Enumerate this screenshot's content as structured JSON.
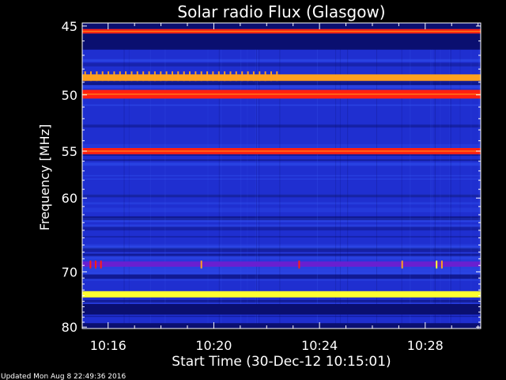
{
  "chart_data": {
    "type": "heatmap",
    "title": "Solar radio Flux (Glasgow)",
    "xlabel": "Start Time (30-Dec-12 10:15:01)",
    "ylabel": "Frequency [MHz]",
    "x_ticks": [
      "10:16",
      "10:20",
      "10:24",
      "10:28"
    ],
    "x_tick_minutes": [
      16,
      20,
      24,
      28
    ],
    "x_range_minutes": [
      15.02,
      30.1
    ],
    "y_ticks": [
      45,
      50,
      55,
      60,
      70,
      80
    ],
    "y_range": [
      44.8,
      80.3
    ],
    "y_scale": "reciprocal",
    "grid": false,
    "colors": {
      "background": "#000000",
      "axes": "#ffffff",
      "quiet": "#1f2fd0",
      "dim": "#0a0f70",
      "moderate": "#6a1fd0",
      "strong": "#ff2010",
      "intense": "#ffa020",
      "saturated": "#ffff30"
    },
    "bands": [
      {
        "freq_low": 44.8,
        "freq_high": 45.2,
        "level": "dim"
      },
      {
        "freq_low": 45.2,
        "freq_high": 45.5,
        "level": "strong"
      },
      {
        "freq_low": 45.5,
        "freq_high": 46.6,
        "level": "dim"
      },
      {
        "freq_low": 48.4,
        "freq_high": 48.9,
        "level": "intense"
      },
      {
        "freq_low": 49.6,
        "freq_high": 50.3,
        "level": "strong"
      },
      {
        "freq_low": 54.7,
        "freq_high": 55.3,
        "level": "strong"
      },
      {
        "freq_low": 68.4,
        "freq_high": 69.2,
        "level": "moderate"
      },
      {
        "freq_low": 73.2,
        "freq_high": 74.3,
        "level": "saturated"
      },
      {
        "freq_low": 75.5,
        "freq_high": 77.5,
        "level": "dim"
      },
      {
        "freq_low": 79.2,
        "freq_high": 80.3,
        "level": "dim"
      }
    ],
    "bursts": [
      {
        "freq": 48.9,
        "minute_start": 15.1,
        "minute_end": 22.5,
        "level": "intense"
      },
      {
        "freq": 69.0,
        "minute": 15.3,
        "level": "strong"
      },
      {
        "freq": 69.0,
        "minute": 15.5,
        "level": "strong"
      },
      {
        "freq": 69.0,
        "minute": 15.7,
        "level": "strong"
      },
      {
        "freq": 69.0,
        "minute": 19.5,
        "level": "intense"
      },
      {
        "freq": 69.0,
        "minute": 23.2,
        "level": "strong"
      },
      {
        "freq": 69.0,
        "minute": 27.1,
        "level": "intense"
      },
      {
        "freq": 69.0,
        "minute": 28.4,
        "level": "saturated"
      },
      {
        "freq": 69.0,
        "minute": 28.6,
        "level": "intense"
      }
    ]
  },
  "footer": {
    "updated": "Updated Mon Aug  8 22:49:36 2016"
  }
}
